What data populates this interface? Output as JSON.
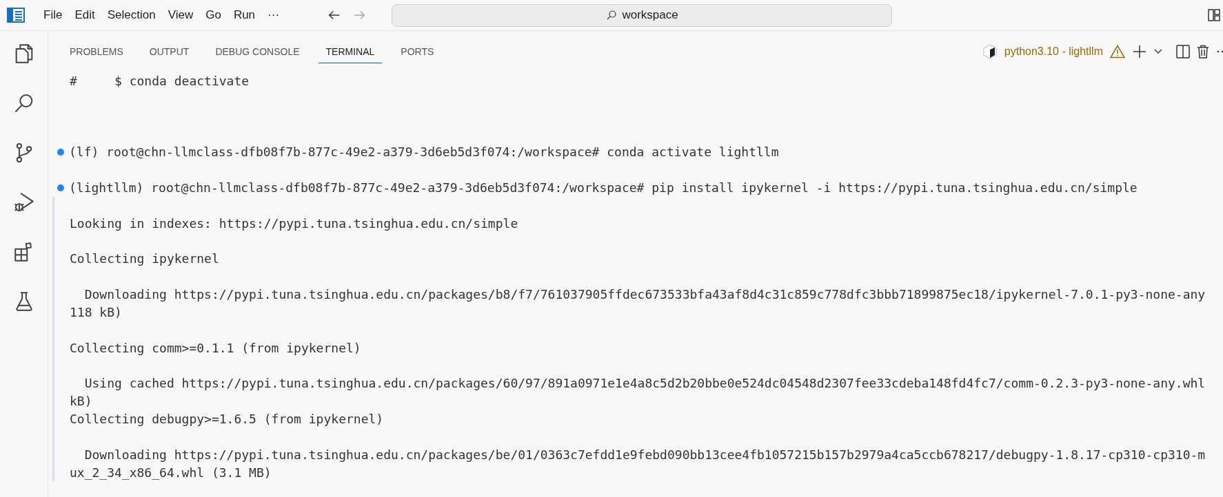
{
  "menu": [
    "File",
    "Edit",
    "Selection",
    "View",
    "Go",
    "Run",
    "···"
  ],
  "navigation": [
    {
      "kind": "back",
      "disabled": false
    },
    {
      "kind": "forward",
      "disabled": true
    }
  ],
  "command_center": {
    "label": "workspace"
  },
  "activity_bar": [
    {
      "kind": "explorer"
    },
    {
      "kind": "search"
    },
    {
      "kind": "source-control"
    },
    {
      "kind": "run-debug"
    },
    {
      "kind": "extensions"
    },
    {
      "kind": "testing"
    }
  ],
  "panel": {
    "tabs": [
      {
        "label": "PROBLEMS",
        "selected": false
      },
      {
        "label": "OUTPUT",
        "selected": false
      },
      {
        "label": "DEBUG CONSOLE",
        "selected": false
      },
      {
        "label": "TERMINAL",
        "selected": true
      },
      {
        "label": "PORTS",
        "selected": false
      }
    ],
    "terminal_profile": "python3.10 - lightllm"
  },
  "terminal": {
    "lines": [
      {
        "kind": "text",
        "text": "#     $ conda deactivate"
      },
      {
        "kind": "blank"
      },
      {
        "kind": "blank"
      },
      {
        "kind": "blank"
      },
      {
        "kind": "command",
        "text": "(lf) root@chn-llmclass-dfb08f7b-877c-49e2-a379-3d6eb5d3f074:/workspace# conda activate lightllm"
      },
      {
        "kind": "blank"
      },
      {
        "kind": "command",
        "text": "(lightllm) root@chn-llmclass-dfb08f7b-877c-49e2-a379-3d6eb5d3f074:/workspace# pip install ipykernel -i https://pypi.tuna.tsinghua.edu.cn/simple",
        "output": [
          {
            "kind": "blank"
          },
          {
            "kind": "text",
            "text": "Looking in indexes: https://pypi.tuna.tsinghua.edu.cn/simple"
          },
          {
            "kind": "blank"
          },
          {
            "kind": "text",
            "text": "Collecting ipykernel"
          },
          {
            "kind": "blank"
          },
          {
            "kind": "text",
            "text": "  Downloading https://pypi.tuna.tsinghua.edu.cn/packages/b8/f7/761037905ffdec673533bfa43af8d4c31c859c778dfc3bbb71899875ec18/ipykernel-7.0.1-py3-none-any"
          },
          {
            "kind": "text",
            "text": "118 kB)"
          },
          {
            "kind": "blank"
          },
          {
            "kind": "text",
            "text": "Collecting comm>=0.1.1 (from ipykernel)"
          },
          {
            "kind": "blank"
          },
          {
            "kind": "text",
            "text": "  Using cached https://pypi.tuna.tsinghua.edu.cn/packages/60/97/891a0971e1e4a8c5d2b20bbe0e524dc04548d2307fee33cdeba148fd4fc7/comm-0.2.3-py3-none-any.whl"
          },
          {
            "kind": "text",
            "text": "kB)"
          },
          {
            "kind": "text",
            "text": "Collecting debugpy>=1.6.5 (from ipykernel)"
          },
          {
            "kind": "blank"
          },
          {
            "kind": "text",
            "text": "  Downloading https://pypi.tuna.tsinghua.edu.cn/packages/be/01/0363c7efdd1e9febd090bb13cee4fb1057215b157b2979a4ca5ccb678217/debugpy-1.8.17-cp310-cp310-m"
          },
          {
            "kind": "text",
            "text": "ux_2_34_x86_64.whl (3.1 MB)"
          }
        ]
      }
    ]
  }
}
